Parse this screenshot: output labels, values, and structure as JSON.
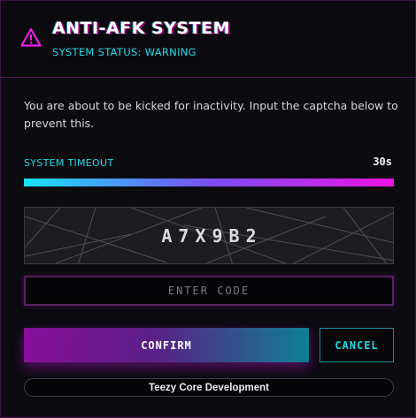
{
  "header": {
    "icon": "warning-triangle-icon",
    "title": "ANTI-AFK SYSTEM",
    "status": "SYSTEM STATUS: WARNING"
  },
  "message": "You are about to be kicked for inactivity. Input the captcha below to prevent this.",
  "timeout": {
    "label": "SYSTEM TIMEOUT",
    "value": "30s",
    "progress": 1.0
  },
  "captcha": {
    "code": "A7X9B2"
  },
  "input": {
    "placeholder": "ENTER CODE",
    "value": ""
  },
  "buttons": {
    "confirm_label": "CONFIRM",
    "cancel_label": "CANCEL"
  },
  "footer": {
    "text": "Teezy Core Development"
  },
  "colors": {
    "accent_cyan": "#20d9e8",
    "accent_magenta": "#ee12e6",
    "background": "#0b0b10"
  }
}
